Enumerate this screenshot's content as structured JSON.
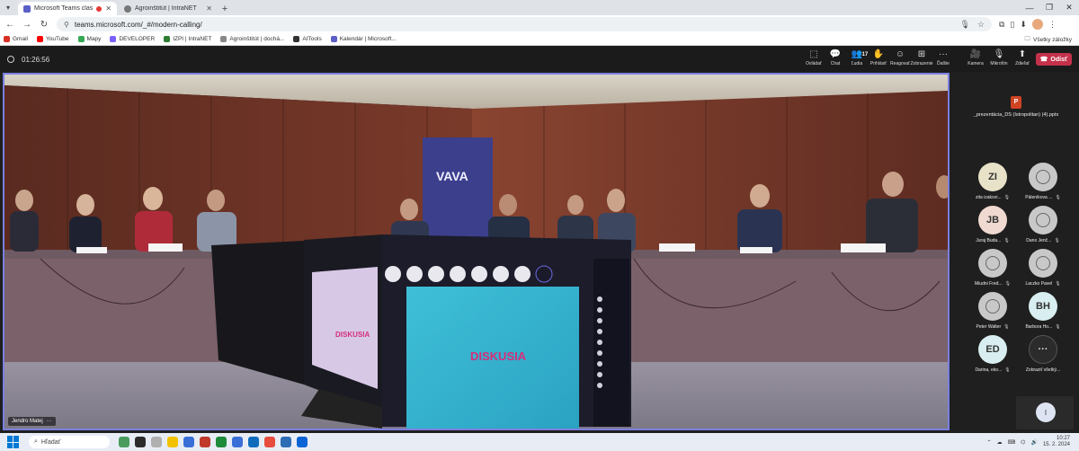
{
  "browser": {
    "tabs": [
      {
        "title": "Microsoft Teams classic",
        "active": true,
        "recording": true
      },
      {
        "title": "Agroinštitút | IntraNET",
        "active": false,
        "recording": false
      }
    ],
    "url": "teams.microsoft.com/_#/modern-calling/",
    "bookmarks": [
      "Gmail",
      "YouTube",
      "Mapy",
      "DEVELOPER",
      "IZPI | IntraNET",
      "Agroinštitút | dochá...",
      "AITools",
      "Kalendár | Microsoft..."
    ],
    "all_bookmarks_label": "Všetky záložky"
  },
  "call": {
    "timer": "01:26:56",
    "tools": [
      {
        "label": "Ovládať",
        "icon": "control-icon",
        "glyph": "⬚"
      },
      {
        "label": "Chat",
        "icon": "chat-icon",
        "glyph": "💬"
      },
      {
        "label": "Ľudia",
        "icon": "people-icon",
        "glyph": "👥",
        "badge": "17"
      },
      {
        "label": "Prihlásiť",
        "icon": "raise-hand-icon",
        "glyph": "✋"
      },
      {
        "label": "Reagovať",
        "icon": "react-icon",
        "glyph": "☺"
      },
      {
        "label": "Zobrazenie",
        "icon": "view-icon",
        "glyph": "⊞"
      },
      {
        "label": "Ďalšie",
        "icon": "more-icon",
        "glyph": "···"
      }
    ],
    "media": [
      {
        "label": "Kamera",
        "icon": "camera-icon",
        "glyph": "🎥"
      },
      {
        "label": "Mikrofón",
        "icon": "microphone-icon",
        "glyph": "🎙"
      },
      {
        "label": "Zdieľať",
        "icon": "share-icon",
        "glyph": "⬆"
      }
    ],
    "leave_label": "Odísť"
  },
  "stage": {
    "presenter_name": "Jendro Matej",
    "banner_text": "VAVA",
    "slide_text": "DISKUSIA"
  },
  "side_panel": {
    "shared_file": "_prezentácia_DS (Istropolitan) (4).pptx",
    "participants": [
      {
        "initials": "ZI",
        "name": "zita izakovi...",
        "color": "#e8e3c8",
        "generic": false
      },
      {
        "initials": "",
        "name": "Pálenikova ...",
        "color": "#c8c8c8",
        "generic": true
      },
      {
        "initials": "JB",
        "name": "Juraj Buda...",
        "color": "#f0d9d0",
        "generic": false
      },
      {
        "initials": "",
        "name": "Dano Jenč...",
        "color": "#c8c8c8",
        "generic": true
      },
      {
        "initials": "",
        "name": "Miudni Fred...",
        "color": "#c8c8c8",
        "generic": true
      },
      {
        "initials": "",
        "name": "Laczko Pavel",
        "color": "#c8c8c8",
        "generic": true
      },
      {
        "initials": "",
        "name": "Peter Walter",
        "color": "#c8c8c8",
        "generic": true
      },
      {
        "initials": "BH",
        "name": "Barbora Ho...",
        "color": "#d8eef0",
        "generic": false
      },
      {
        "initials": "ED",
        "name": "Darina, eko...",
        "color": "#d8eef0",
        "generic": false
      }
    ],
    "show_all_label": "Zobraziť všetký...",
    "self_initial": "I"
  },
  "taskbar": {
    "search_placeholder": "Hľadať",
    "time": "10:27",
    "date": "15. 2. 2024",
    "apps": [
      "#4a9c5d",
      "#2c2c2c",
      "#b0b0b0",
      "#f2c200",
      "#3a6fd8",
      "#c0392b",
      "#1d8b3a",
      "#3a6fd8",
      "#0f6cbd",
      "#e74c3c",
      "#2d6db5",
      "#0a64d6"
    ]
  }
}
